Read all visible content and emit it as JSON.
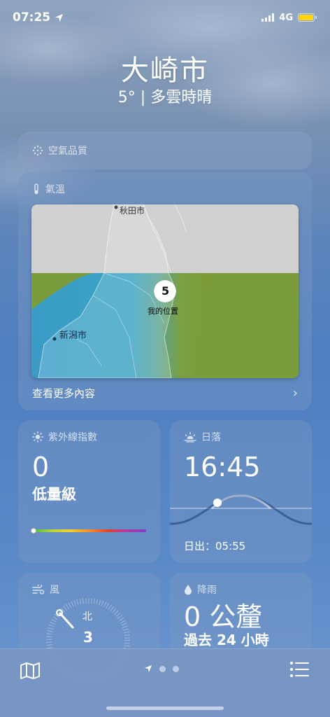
{
  "status": {
    "time": "07:25",
    "network": "4G"
  },
  "location": {
    "city": "大崎市",
    "summary": "5° | 多雲時晴"
  },
  "air_quality": {
    "title": "空氣品質"
  },
  "temperature_map": {
    "title": "氣溫",
    "city_label_1": "秋田市",
    "city_label_2": "新潟市",
    "my_temp": "5",
    "my_label": "我的位置",
    "more": "查看更多內容"
  },
  "uv": {
    "title": "紫外線指數",
    "value": "0",
    "level": "低量級",
    "fraction": 0.0
  },
  "sunset": {
    "title": "日落",
    "time": "16:45",
    "sunrise": "日出：05:55"
  },
  "wind": {
    "title": "風",
    "north": "北",
    "speed": "3"
  },
  "rain": {
    "title": "降雨",
    "amount": "0 公釐",
    "period": "過去 24 小時"
  },
  "colors": {
    "battery": "#ffd60a",
    "map_cold": "#3b97c2",
    "map_mild": "#7c9a3c"
  }
}
